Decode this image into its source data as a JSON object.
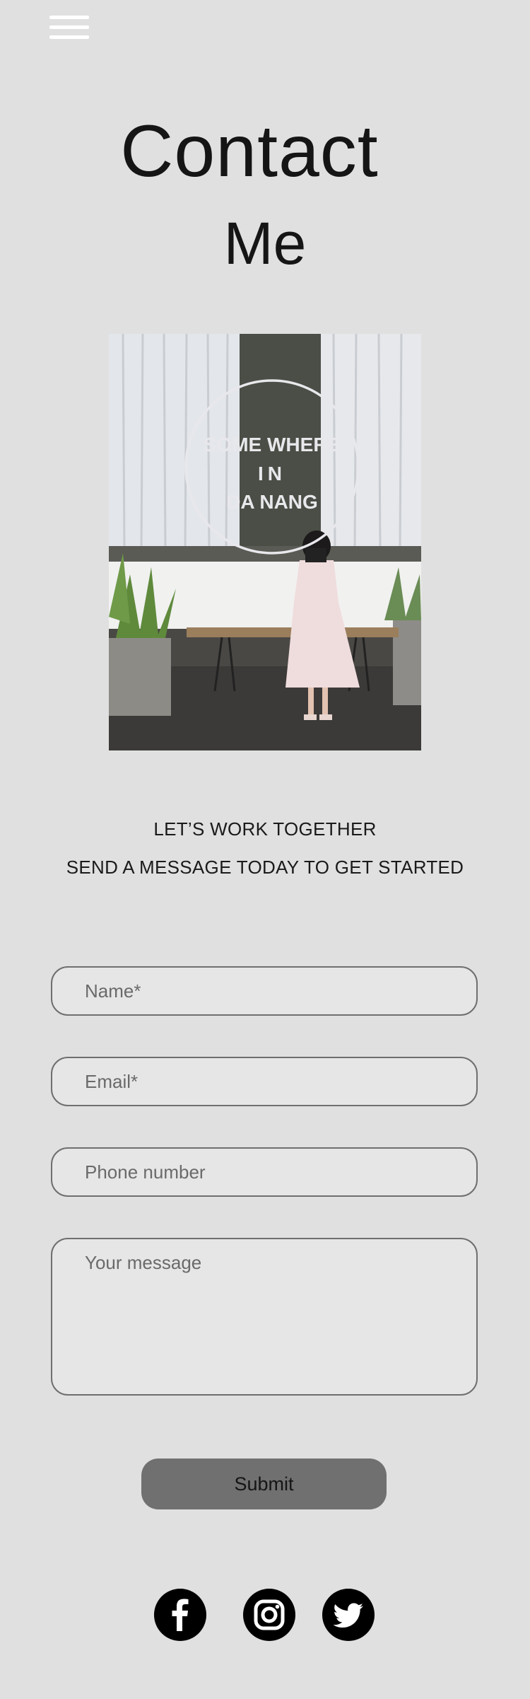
{
  "header": {
    "menu_icon": "hamburger-menu-icon"
  },
  "page": {
    "title_line1": "Contact",
    "title_line2": "Me"
  },
  "photo": {
    "sign_line1": "SOME WHERE",
    "sign_line2": "IN",
    "sign_line3": "DA NANG"
  },
  "intro": {
    "line1": "LET’S WORK TOGETHER",
    "line2": "SEND A MESSAGE TODAY TO GET STARTED"
  },
  "form": {
    "name_placeholder": "Name*",
    "email_placeholder": "Email*",
    "phone_placeholder": "Phone number",
    "message_placeholder": "Your message",
    "submit_label": "Submit"
  },
  "social": {
    "icons": [
      "facebook-icon",
      "instagram-icon",
      "twitter-icon"
    ]
  },
  "colors": {
    "background": "#e0e0e0",
    "submit_button": "#707070",
    "field_border": "#6f6f6f"
  }
}
